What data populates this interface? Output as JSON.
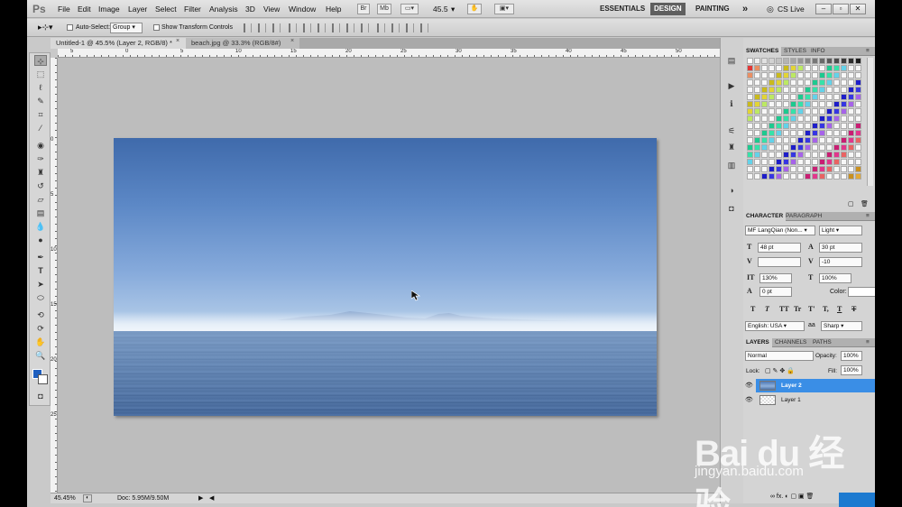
{
  "app": {
    "logo": "Ps"
  },
  "menu": [
    "File",
    "Edit",
    "Image",
    "Layer",
    "Select",
    "Filter",
    "Analysis",
    "3D",
    "View",
    "Window",
    "Help"
  ],
  "menubar_controls": {
    "br": "Br",
    "mb": "Mb",
    "zoom": "45.5",
    "zoom_arrow": "▾"
  },
  "workspaces": {
    "essentials": "ESSENTIALS",
    "design": "DESIGN",
    "painting": "PAINTING",
    "more": "»",
    "cs_live": "CS Live"
  },
  "options": {
    "auto_select_label": "Auto-Select:",
    "auto_select_value": "Group",
    "show_transform": "Show Transform Controls"
  },
  "tabs": [
    {
      "label": "Untitled-1 @ 45.5% (Layer 2, RGB/8) *",
      "close": "×"
    },
    {
      "label": "beach.jpg @ 33.3% (RGB/8#)",
      "close": "×"
    }
  ],
  "rulers": {
    "h_ticks": [
      "5",
      "0",
      "5",
      "10",
      "15",
      "20",
      "25",
      "30",
      "35",
      "40",
      "45",
      "50"
    ],
    "v_ticks": [
      "0",
      "5",
      "10",
      "15",
      "20",
      "25"
    ]
  },
  "status": {
    "zoom": "45.45%",
    "doc": "Doc: 5.95M/9.50M"
  },
  "swatches_panel": {
    "tabs": [
      "SWATCHES",
      "STYLES",
      "INFO"
    ]
  },
  "character_panel": {
    "tabs": [
      "CHARACTER",
      "PARAGRAPH"
    ],
    "font_family": "MF LangQian (Non...",
    "font_style": "Light",
    "font_size": "48 pt",
    "leading": "30 pt",
    "kerning": "",
    "tracking": "-10",
    "vertical_scale": "130%",
    "horizontal_scale": "100%",
    "baseline_shift": "0 pt",
    "color_label": "Color:",
    "language": "English: USA",
    "aa_label": "aa",
    "antialias": "Sharp",
    "style_buttons": [
      "T",
      "T",
      "TT",
      "Tr",
      "T'",
      "T,",
      "T",
      "T"
    ]
  },
  "layers_panel": {
    "tabs": [
      "LAYERS",
      "CHANNELS",
      "PATHS"
    ],
    "blend_mode": "Normal",
    "opacity_label": "Opacity:",
    "opacity": "100%",
    "lock_label": "Lock:",
    "fill_label": "Fill:",
    "fill": "100%",
    "layers": [
      {
        "name": "Layer 2",
        "selected": true
      },
      {
        "name": "Layer 1",
        "selected": false
      }
    ],
    "footer_icons": "∞ fx. ◐ ▢ ▣ 🗑"
  },
  "watermark": {
    "brand": "Bai du 经验",
    "url": "jingyan.baidu.com"
  },
  "colors": {
    "accent": "#3a8ee6",
    "sky_top": "#3f6aab",
    "sea": "#4b6fa1",
    "foreground": "#1f5fbf"
  }
}
